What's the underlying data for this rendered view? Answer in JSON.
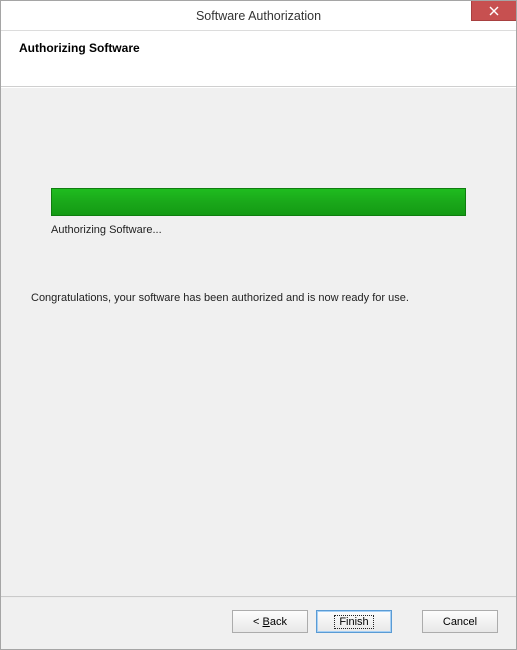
{
  "window": {
    "title": "Software Authorization"
  },
  "header": {
    "title": "Authorizing Software"
  },
  "progress": {
    "label": "Authorizing Software...",
    "percent": 100
  },
  "message": {
    "congrats": "Congratulations, your software has been authorized and is now ready for use."
  },
  "buttons": {
    "back_prefix": "< ",
    "back_letter": "B",
    "back_rest": "ack",
    "finish": "Finish",
    "cancel": "Cancel"
  },
  "colors": {
    "close_bg": "#c75050",
    "progress_fill": "#1aa81a"
  }
}
